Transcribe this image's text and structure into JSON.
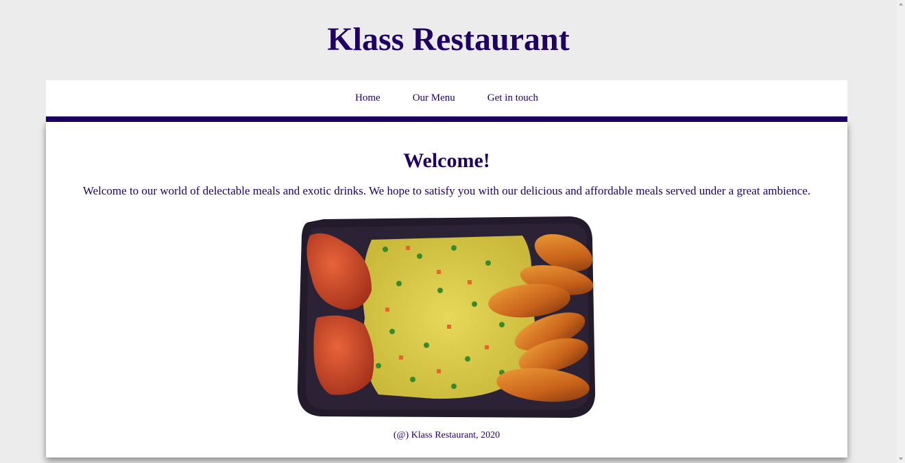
{
  "site": {
    "title": "Klass Restaurant"
  },
  "nav": {
    "items": [
      {
        "label": "Home"
      },
      {
        "label": "Our Menu"
      },
      {
        "label": "Get in touch"
      }
    ]
  },
  "main": {
    "heading": "Welcome!",
    "intro": "Welcome to our world of delectable meals and exotic drinks. We hope to satisfy you with our delicious and affordable meals served under a great ambience.",
    "image_icon": "jollof-rice-plate-image"
  },
  "footer": {
    "text": "(@) Klass Restaurant, 2020"
  },
  "colors": {
    "brand": "#1e0063",
    "page_background": "#ececec",
    "card_background": "#ffffff"
  }
}
